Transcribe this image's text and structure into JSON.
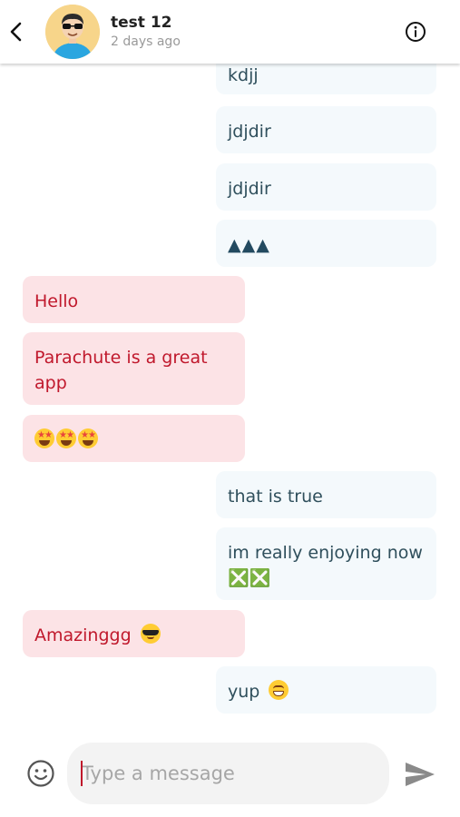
{
  "header": {
    "name": "test 12",
    "status": "2 days ago"
  },
  "messages": [
    {
      "side": "sent",
      "text": "kdjj"
    },
    {
      "side": "sent",
      "text": "jdjdir"
    },
    {
      "side": "sent",
      "text": "jdjdir"
    },
    {
      "side": "sent",
      "text": "▲▲▲"
    },
    {
      "side": "received",
      "text": "Hello"
    },
    {
      "side": "received",
      "text": "Parachute is a great app"
    },
    {
      "side": "received",
      "emojis": [
        "star-struck-emoji",
        "star-struck-emoji",
        "star-struck-emoji"
      ]
    },
    {
      "side": "sent",
      "text": "that is true"
    },
    {
      "side": "sent",
      "text": "im really enjoying now ❎❎"
    },
    {
      "side": "received",
      "text": "Amazinggg",
      "emoji": "sunglasses-emoji"
    },
    {
      "side": "sent",
      "text": "yup",
      "emoji": "grinning-emoji"
    }
  ],
  "composer": {
    "placeholder": "Type a message"
  },
  "colors": {
    "sent_bubble": "#f4f9fc",
    "sent_text": "#2f4f5c",
    "received_bubble": "#fce3e6",
    "received_text": "#c0182c"
  }
}
